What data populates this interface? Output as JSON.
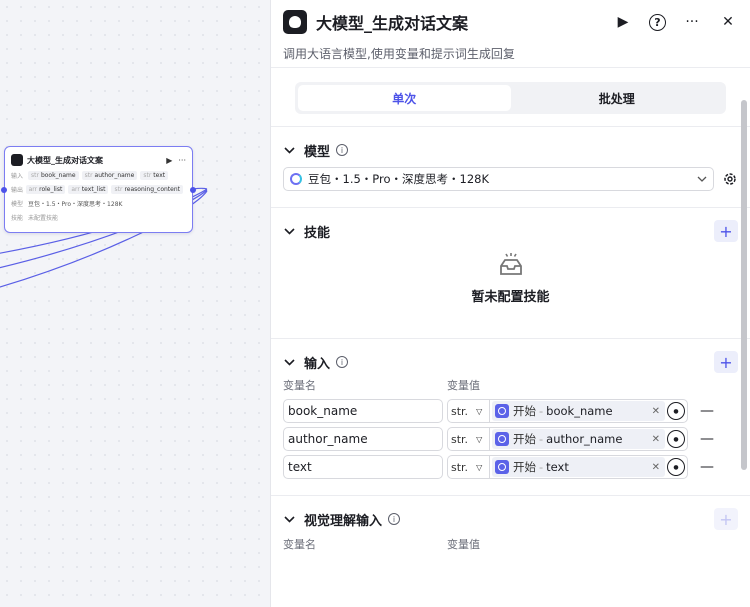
{
  "canvas": {
    "node": {
      "title": "大模型_生成对话文案",
      "input_label": "输入",
      "output_label": "输出",
      "model_label": "模型",
      "skill_label": "技能",
      "inputs": [
        "book_name",
        "author_name",
        "text"
      ],
      "outputs": [
        "role_list",
        "text_list",
        "reasoning_content"
      ],
      "model_value": "豆包・1.5・Pro・深度思考・128K",
      "skill_value": "未配置技能",
      "input_type": "str",
      "output_types": [
        "arr",
        "arr",
        "str"
      ]
    }
  },
  "panel": {
    "title": "大模型_生成对话文案",
    "description": "调用大语言模型,使用变量和提示词生成回复",
    "tabs": [
      {
        "label": "单次",
        "active": true
      },
      {
        "label": "批处理",
        "active": false
      }
    ],
    "model_section": {
      "title": "模型",
      "selected": "豆包・1.5・Pro・深度思考・128K"
    },
    "skills_section": {
      "title": "技能",
      "empty_text": "暂未配置技能"
    },
    "input_section": {
      "title": "输入",
      "col_name": "变量名",
      "col_value": "变量值",
      "rows": [
        {
          "name": "book_name",
          "type": "str.",
          "source": "开始",
          "var": "book_name"
        },
        {
          "name": "author_name",
          "type": "str.",
          "source": "开始",
          "var": "author_name"
        },
        {
          "name": "text",
          "type": "str.",
          "source": "开始",
          "var": "text"
        }
      ]
    },
    "vision_section": {
      "title": "视觉理解输入",
      "col_name": "变量名",
      "col_value": "变量值"
    }
  },
  "colors": {
    "accent": "#4d53e8",
    "node_border": "#7c7df2",
    "canvas_bg": "#f3f4f8"
  }
}
